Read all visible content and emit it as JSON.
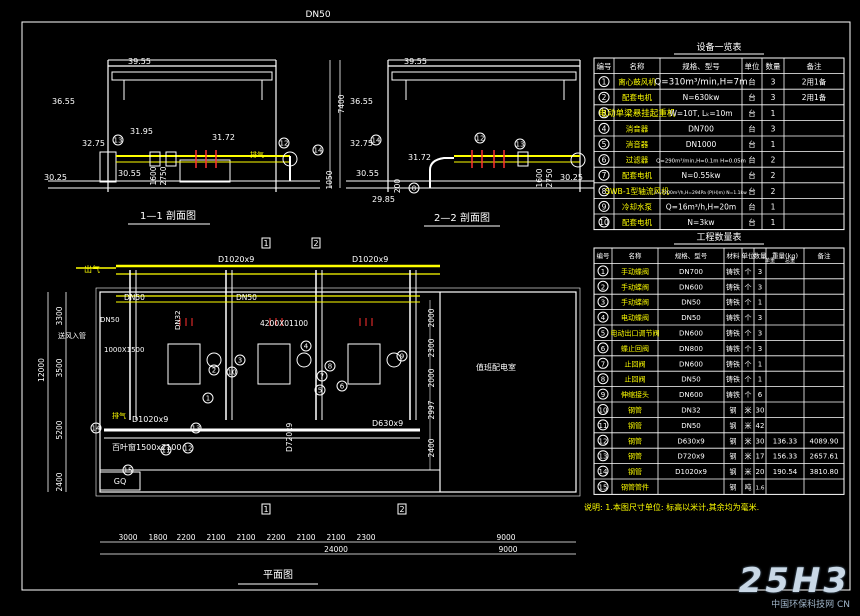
{
  "top_label": "DN50",
  "section1": {
    "title": "1—1 剖面图",
    "elev": [
      "39.55",
      "36.55",
      "32.75",
      "31.95",
      "31.72",
      "30.55",
      "30.25"
    ],
    "dims": [
      "1600",
      "2750",
      "13",
      "12",
      "14",
      "1050"
    ],
    "pipe_labels": [
      "排气"
    ]
  },
  "section2": {
    "title": "2—2 剖面图",
    "elev": [
      "39.55",
      "36.55",
      "32.75",
      "31.72",
      "30.55",
      "30.25",
      "29.85"
    ],
    "dims": [
      "7400",
      "1600",
      "2750",
      "14",
      "12",
      "13",
      "8",
      "200"
    ]
  },
  "plan": {
    "title": "平面图",
    "labels": {
      "d1020_left": "D1020x9",
      "d1020_right": "D1020x9",
      "dn50_a": "DN50",
      "dn50_b": "DN50",
      "dn32": "DN32",
      "d1020_bottom": "D1020x9",
      "d630": "D630x9",
      "d720": "D720x9",
      "d4200": "4200X01100",
      "louver": "百叶窗1500x2100",
      "room": "值班配电室",
      "inlet": "出气",
      "drain": "送风入管",
      "air": "排气",
      "m1000": "1000X1500",
      "dn50c": "DN50"
    },
    "section_markers": [
      "1",
      "2",
      "1",
      "2"
    ],
    "left_dims": [
      "3300",
      "3500",
      "12000",
      "5200",
      "2400"
    ],
    "right_dims": [
      "2000",
      "2300",
      "2000",
      "2997",
      "2400"
    ],
    "bottom_dims": [
      "3000",
      "1800",
      "2200",
      "2100",
      "2100",
      "2200",
      "2100",
      "2100",
      "2300",
      "9000"
    ],
    "total_dims": [
      "24000",
      "9000"
    ],
    "callouts": [
      "1",
      "2",
      "3",
      "4",
      "5",
      "6",
      "7",
      "8",
      "9",
      "10",
      "11",
      "12",
      "13",
      "14",
      "15"
    ],
    "gq": "GQ"
  },
  "equipment_table": {
    "title": "设备一览表",
    "headers": [
      "编号",
      "名称",
      "规格、型号",
      "单位",
      "数量",
      "备注"
    ],
    "rows": [
      [
        "1",
        "离心鼓风机",
        "Q=310m³/min,H=7m",
        "台",
        "3",
        "2用1备"
      ],
      [
        "2",
        "配套电机",
        "N=630kw",
        "台",
        "3",
        "2用1备"
      ],
      [
        "3",
        "电动单梁悬挂起重机",
        "W=10T, Lₖ=10m",
        "台",
        "1",
        ""
      ],
      [
        "4",
        "消音器",
        "DN700",
        "台",
        "3",
        ""
      ],
      [
        "5",
        "消音器",
        "DN1000",
        "台",
        "1",
        ""
      ],
      [
        "6",
        "过滤器",
        "Q=290m³/min,H=0.1m H=0.05m",
        "台",
        "2",
        ""
      ],
      [
        "7",
        "配套电机",
        "N=0.55kw",
        "台",
        "2",
        ""
      ],
      [
        "8",
        "SWB-1型轴流风机",
        "L=7200m³/h,H=294Pa (P(H)m) N=1.1kw",
        "台",
        "2",
        ""
      ],
      [
        "9",
        "冷却水泵",
        "Q=16m³/h,H=20m",
        "台",
        "1",
        ""
      ],
      [
        "10",
        "配套电机",
        "N=3kw",
        "台",
        "1",
        ""
      ]
    ]
  },
  "material_table": {
    "title": "工程数量表",
    "headers": [
      "编号",
      "名称",
      "规格、型号",
      "材料",
      "单位",
      "数量",
      "重量(kg)",
      "备注"
    ],
    "weight_sub": [
      "单重",
      "总重"
    ],
    "rows": [
      [
        "1",
        "手动蝶阀",
        "DN700",
        "铸铁",
        "个",
        "3",
        "",
        ""
      ],
      [
        "2",
        "手动蝶阀",
        "DN600",
        "铸铁",
        "个",
        "3",
        "",
        ""
      ],
      [
        "3",
        "手动蝶阀",
        "DN50",
        "铸铁",
        "个",
        "1",
        "",
        ""
      ],
      [
        "4",
        "电动蝶阀",
        "DN50",
        "铸铁",
        "个",
        "3",
        "",
        ""
      ],
      [
        "5",
        "电动出口调节阀",
        "DN600",
        "铸铁",
        "个",
        "3",
        "",
        ""
      ],
      [
        "6",
        "蝶止回阀",
        "DN800",
        "铸铁",
        "个",
        "3",
        "",
        ""
      ],
      [
        "7",
        "止回阀",
        "DN600",
        "铸铁",
        "个",
        "1",
        "",
        ""
      ],
      [
        "8",
        "止回阀",
        "DN50",
        "铸铁",
        "个",
        "1",
        "",
        ""
      ],
      [
        "9",
        "伸缩接头",
        "DN600",
        "铸铁",
        "个",
        "6",
        "",
        ""
      ],
      [
        "10",
        "钢管",
        "DN32",
        "钢",
        "米",
        "30",
        "",
        ""
      ],
      [
        "11",
        "钢管",
        "DN50",
        "钢",
        "米",
        "42",
        "",
        ""
      ],
      [
        "12",
        "钢管",
        "D630x9",
        "钢",
        "米",
        "30",
        "136.33",
        "4089.90"
      ],
      [
        "13",
        "钢管",
        "D720x9",
        "钢",
        "米",
        "17",
        "156.33",
        "2657.61"
      ],
      [
        "14",
        "钢管",
        "D1020x9",
        "钢",
        "米",
        "20",
        "190.54",
        "3810.80"
      ],
      [
        "15",
        "钢管管件",
        "",
        "钢",
        "吨",
        "1.6",
        "",
        ""
      ]
    ]
  },
  "note": "说明: 1.本图尺寸单位: 标高以米计,其余均为毫米.",
  "watermark": {
    "big": "25H3",
    "small": "中国环保科技网 CN"
  },
  "colors": {
    "background": "#000000",
    "frame": "#ffffff",
    "pipe_air": "#ffffff",
    "pipe_yellow": "#ffff00",
    "equipment": "#ffffff",
    "accent_red": "#ff3030",
    "dims": "#ffffff"
  }
}
